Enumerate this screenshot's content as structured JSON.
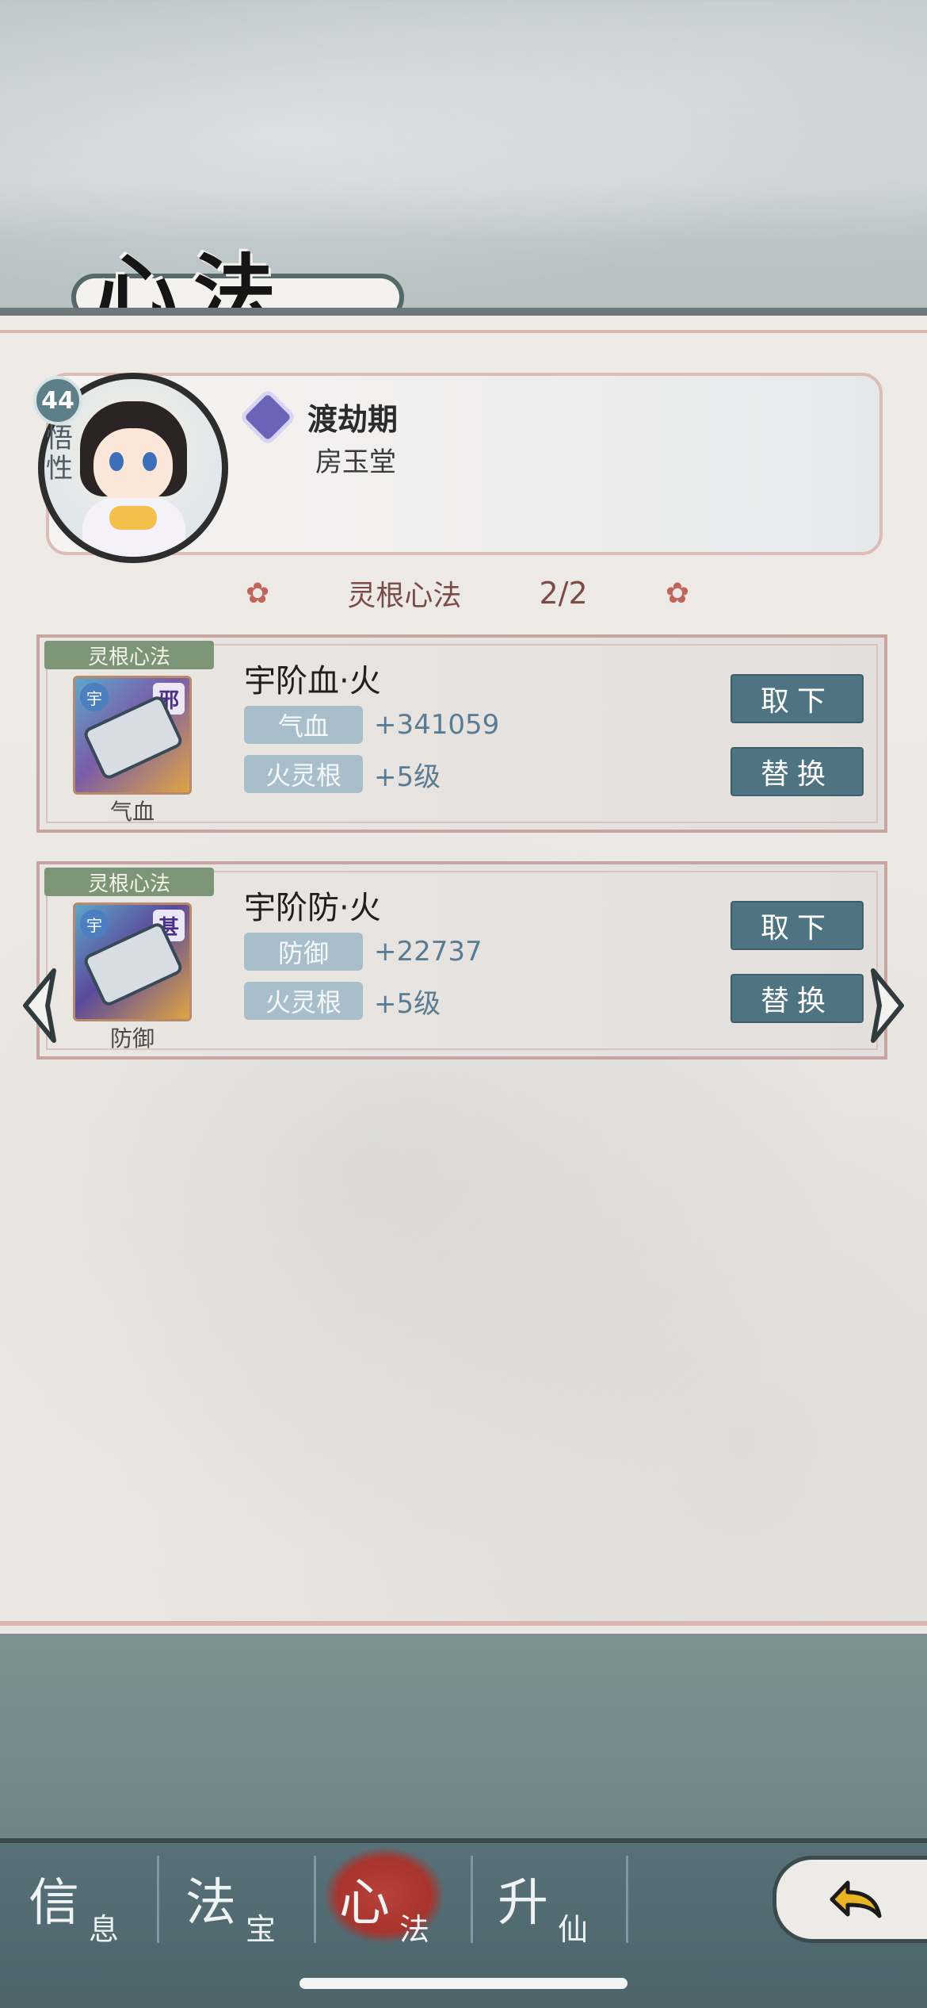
{
  "page_title": "心法",
  "profile": {
    "level": "44",
    "wuxing_label": "悟性",
    "realm": "渡劫期",
    "name": "房玉堂"
  },
  "section": {
    "title": "灵根心法",
    "count": "2/2"
  },
  "techniques": [
    {
      "tag": "灵根心法",
      "icon_seal": "邪",
      "icon_grade": "宇",
      "icon_label": "气血",
      "name": "宇阶血·火",
      "stats": [
        {
          "label": "气血",
          "value": "+341059"
        },
        {
          "label": "火灵根",
          "value": "+5级"
        }
      ],
      "btn_remove": "取下",
      "btn_replace": "替换"
    },
    {
      "tag": "灵根心法",
      "icon_seal": "甚",
      "icon_grade": "宇",
      "icon_label": "防御",
      "name": "宇阶防·火",
      "stats": [
        {
          "label": "防御",
          "value": "+22737"
        },
        {
          "label": "火灵根",
          "value": "+5级"
        }
      ],
      "btn_remove": "取下",
      "btn_replace": "替换"
    }
  ],
  "nav": {
    "tabs": [
      {
        "big": "信",
        "small": "息"
      },
      {
        "big": "法",
        "small": "宝"
      },
      {
        "big": "心",
        "small": "法"
      },
      {
        "big": "升",
        "small": "仙"
      }
    ],
    "active_tab": 2
  },
  "icons": {
    "prev": "chevron-left-icon",
    "next": "chevron-right-icon",
    "back": "back-arrow-icon",
    "flower": "flower-icon",
    "realm": "realm-badge-icon"
  },
  "colors": {
    "accent_red": "#b7413a",
    "button_teal": "#4e7481",
    "tag_green": "#7d9577",
    "stat_label_blue": "#a8bfcb"
  }
}
